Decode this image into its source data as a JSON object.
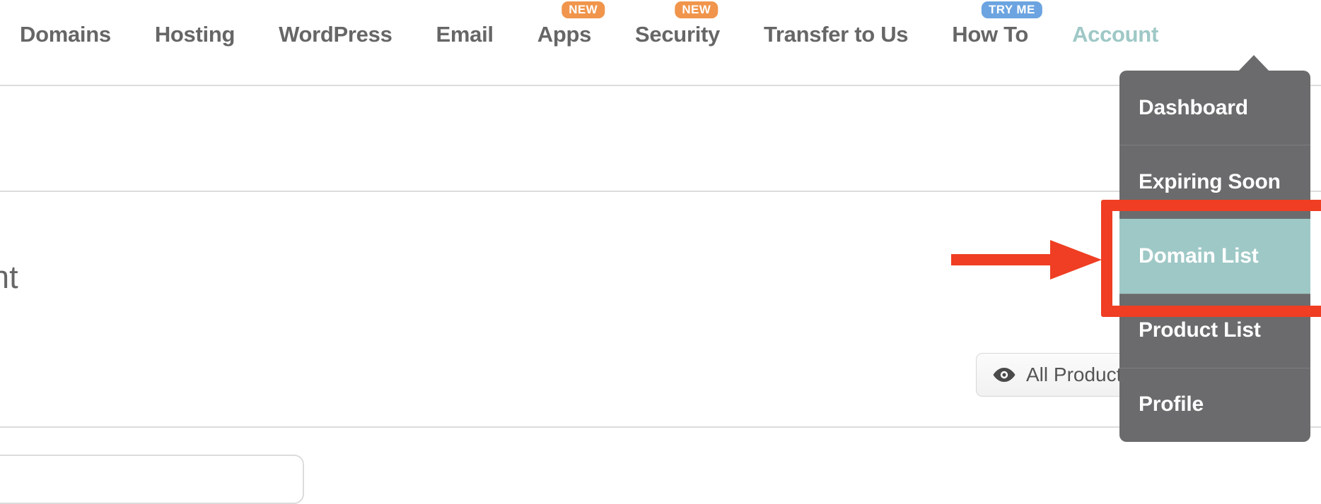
{
  "nav": {
    "items": [
      {
        "label": "Domains",
        "badge": null,
        "badge_type": null,
        "active": false
      },
      {
        "label": "Hosting",
        "badge": null,
        "badge_type": null,
        "active": false
      },
      {
        "label": "WordPress",
        "badge": null,
        "badge_type": null,
        "active": false
      },
      {
        "label": "Email",
        "badge": null,
        "badge_type": null,
        "active": false
      },
      {
        "label": "Apps",
        "badge": "NEW",
        "badge_type": "new",
        "active": false
      },
      {
        "label": "Security",
        "badge": "NEW",
        "badge_type": "new",
        "active": false
      },
      {
        "label": "Transfer to Us",
        "badge": null,
        "badge_type": null,
        "active": false
      },
      {
        "label": "How To",
        "badge": "TRY ME",
        "badge_type": "try",
        "active": false
      },
      {
        "label": "Account",
        "badge": null,
        "badge_type": null,
        "active": true
      }
    ]
  },
  "account_dropdown": {
    "items": [
      {
        "label": "Dashboard",
        "highlighted": false
      },
      {
        "label": "Expiring Soon",
        "highlighted": false
      },
      {
        "label": "Domain List",
        "highlighted": true
      },
      {
        "label": "Product List",
        "highlighted": false
      },
      {
        "label": "Profile",
        "highlighted": false
      }
    ]
  },
  "main": {
    "heading_partial": "ount",
    "all_products_button": {
      "label": "All Product",
      "icon": "eye-icon"
    }
  },
  "annotations": {
    "highlight_box_color": "#ef3e23",
    "arrow_color": "#ef3e23",
    "target_label": "Domain List"
  },
  "colors": {
    "nav_text": "#666666",
    "nav_active_text": "#9ec8c6",
    "badge_new": "#f0954b",
    "badge_try": "#6ba4e0",
    "dropdown_bg": "#6b6b6d",
    "dropdown_highlight": "#9ec8c6",
    "divider": "#dcdcdc",
    "annotation_red": "#ef3e23"
  }
}
